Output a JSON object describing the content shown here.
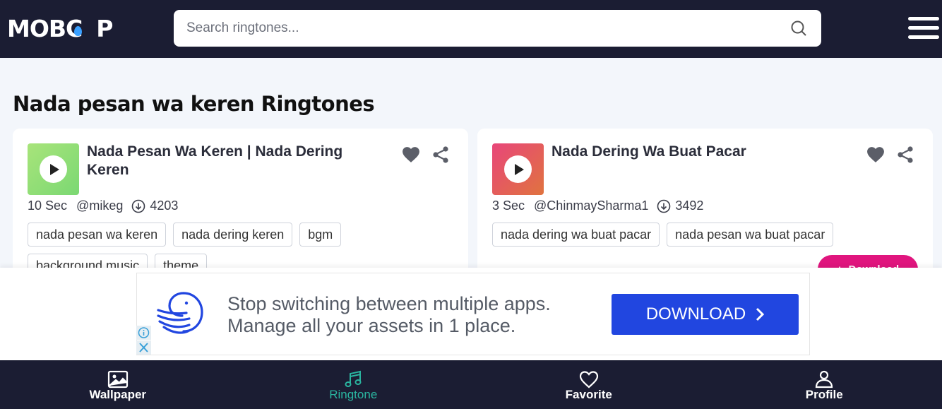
{
  "header": {
    "logo_text": "MOBC",
    "logo_tail": "P",
    "search_placeholder": "Search ringtones...",
    "accent_color": "#3aa0ff"
  },
  "page": {
    "title": "Nada pesan wa keren Ringtones"
  },
  "ringtones": [
    {
      "title": "Nada Pesan Wa Keren | Nada Dering Keren",
      "duration": "10 Sec",
      "author": "@mikeg",
      "downloads": "4203",
      "tags": [
        "nada pesan wa keren",
        "nada dering keren",
        "bgm",
        "background music",
        "theme"
      ],
      "thumb_gradient": [
        "#a8e47a",
        "#7bd873"
      ]
    },
    {
      "title": "Nada Dering Wa Buat Pacar",
      "duration": "3 Sec",
      "author": "@ChinmaySharma1",
      "downloads": "3492",
      "tags": [
        "nada dering wa buat pacar",
        "nada pesan wa buat pacar"
      ],
      "download_label": "Download",
      "thumb_gradient": [
        "#e8467a",
        "#e0733f"
      ]
    }
  ],
  "ad": {
    "line1": "Stop switching between multiple apps.",
    "line2": "Manage all your assets in 1 place.",
    "button_label": "DOWNLOAD",
    "button_color": "#2146e0"
  },
  "bottom_nav": {
    "items": [
      {
        "label": "Wallpaper",
        "icon": "image-icon"
      },
      {
        "label": "Ringtone",
        "icon": "music-note-icon",
        "active": true
      },
      {
        "label": "Favorite",
        "icon": "heart-outline-icon"
      },
      {
        "label": "Profile",
        "icon": "user-icon"
      }
    ],
    "active_color": "#2ab5a0"
  }
}
